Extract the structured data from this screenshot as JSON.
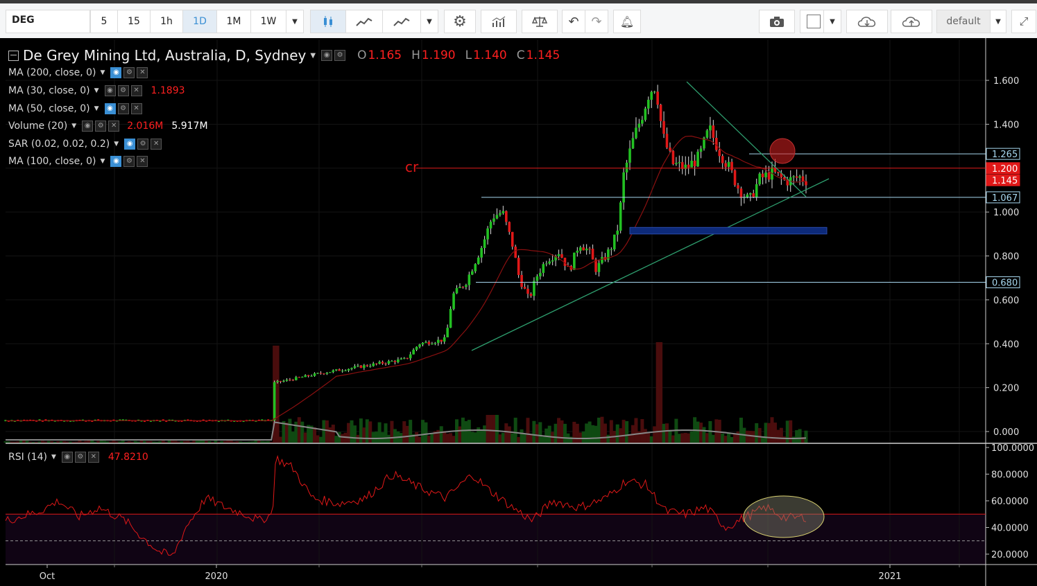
{
  "toolbar": {
    "symbol": "DEG",
    "intervals": [
      "5",
      "15",
      "1h",
      "1D",
      "1M",
      "1W"
    ],
    "active_interval": "1D",
    "layout_name": "default",
    "icons": [
      "candles-icon",
      "area-chart-icon",
      "line-chart-icon",
      "settings-gear-icon",
      "indicators-icon",
      "compare-scales-icon",
      "undo-icon",
      "redo-icon",
      "add-alert-icon",
      "camera-icon",
      "drawing-color-square-icon",
      "cloud-download-icon",
      "cloud-upload-icon",
      "fullscreen-icon"
    ]
  },
  "legend": {
    "title": "De Grey Mining Ltd, Australia, D, Sydney",
    "ohlc": {
      "o_label": "O",
      "o": "1.165",
      "h_label": "H",
      "h": "1.190",
      "l_label": "L",
      "l": "1.140",
      "c_label": "C",
      "c": "1.145"
    },
    "indicators": [
      {
        "name": "MA (200, close, 0)",
        "value": ""
      },
      {
        "name": "MA (30, close, 0)",
        "value": "1.1893"
      },
      {
        "name": "MA (50, close, 0)",
        "value": ""
      },
      {
        "name": "Volume (20)",
        "value": "2.016M",
        "value2": "5.917M"
      },
      {
        "name": "SAR (0.02, 0.02, 0.2)",
        "value": ""
      },
      {
        "name": "MA (100, close, 0)",
        "value": ""
      }
    ],
    "rsi": {
      "name": "RSI (14)",
      "value": "47.8210"
    }
  },
  "annotation_text": "cr",
  "price_axis": {
    "ticks": [
      "1.600",
      "1.400",
      "1.200",
      "1.000",
      "0.800",
      "0.600",
      "0.400",
      "0.200",
      "0.000"
    ],
    "tick_values": [
      1.6,
      1.4,
      1.2,
      1.0,
      0.8,
      0.6,
      0.4,
      0.2,
      0.0
    ],
    "badges": [
      {
        "label": "1.265",
        "value": 1.265,
        "color": "#a8d8f0"
      },
      {
        "label": "1.200",
        "value": 1.2,
        "color": "#e01818"
      },
      {
        "label": "1.145",
        "value": 1.145,
        "color": "#e01818"
      },
      {
        "label": "1.067",
        "value": 1.067,
        "color": "#a8d8f0"
      },
      {
        "label": "0.680",
        "value": 0.68,
        "color": "#a8d8f0"
      }
    ]
  },
  "rsi_axis": {
    "ticks": [
      "100.0000",
      "80.0000",
      "60.0000",
      "40.0000",
      "20.0000"
    ],
    "tick_values": [
      100,
      80,
      60,
      40,
      20
    ]
  },
  "time_axis": {
    "labels": [
      "Oct",
      "2020",
      "2021"
    ]
  },
  "colors": {
    "up": "#22c022",
    "down": "#e01818",
    "accent": "#3a8fd4",
    "sr_line": "#a8d8f0",
    "resistance": "#e01818",
    "trend": "#2e9e6e",
    "zone": "#0d2a7a"
  },
  "chart_data": [
    {
      "type": "candlestick",
      "name": "De Grey Mining Ltd",
      "ylim": [
        0,
        1.6
      ],
      "last": {
        "open": 1.165,
        "high": 1.19,
        "low": 1.14,
        "close": 1.145
      },
      "key_points": [
        {
          "x": "2019-09",
          "y": 0.05
        },
        {
          "x": "2020-02",
          "y": 0.05
        },
        {
          "x": "2020-02",
          "y": 0.22
        },
        {
          "x": "2020-05",
          "y": 0.3
        },
        {
          "x": "2020-06",
          "y": 0.62
        },
        {
          "x": "2020-06",
          "y": 1.06
        },
        {
          "x": "2020-07",
          "y": 0.6
        },
        {
          "x": "2020-08",
          "y": 0.88
        },
        {
          "x": "2020-09",
          "y": 0.7
        },
        {
          "x": "2020-09",
          "y": 1.25
        },
        {
          "x": "2020-09",
          "y": 1.6
        },
        {
          "x": "2020-10",
          "y": 1.2
        },
        {
          "x": "2020-11",
          "y": 1.05
        },
        {
          "x": "2020-11",
          "y": 1.145
        }
      ],
      "horizontal_levels": [
        1.265,
        1.2,
        1.067,
        0.68
      ],
      "zone": [
        0.9,
        0.93
      ]
    },
    {
      "type": "line",
      "name": "RSI (14)",
      "ylim": [
        0,
        100
      ],
      "last": 47.821,
      "levels": [
        50,
        30
      ]
    }
  ]
}
